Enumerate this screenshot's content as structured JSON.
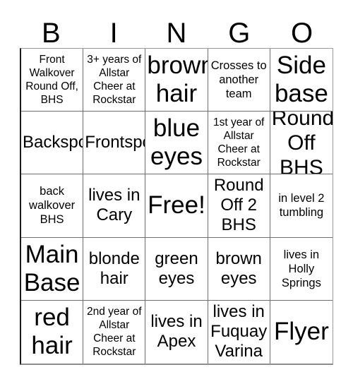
{
  "card": {
    "header_letters": [
      "B",
      "I",
      "N",
      "G",
      "O"
    ],
    "rows": [
      [
        {
          "text": "Front Walkover Round Off, BHS",
          "size": "t-xs"
        },
        {
          "text": "3+ years of Allstar Cheer at Rockstar",
          "size": "t-xs"
        },
        {
          "text": "brown hair",
          "size": "t-xl"
        },
        {
          "text": "Crosses to another team",
          "size": "t-sm"
        },
        {
          "text": "Side base",
          "size": "t-xl"
        }
      ],
      [
        {
          "text": "Backspot",
          "size": "t-md"
        },
        {
          "text": "Frontspot",
          "size": "t-md"
        },
        {
          "text": "blue eyes",
          "size": "t-xl"
        },
        {
          "text": "1st year of Allstar Cheer at Rockstar",
          "size": "t-xs"
        },
        {
          "text": "Round Off BHS",
          "size": "t-lg"
        }
      ],
      [
        {
          "text": "back walkover BHS",
          "size": "t-sm"
        },
        {
          "text": "lives in Cary",
          "size": "t-md"
        },
        {
          "text": "Free!",
          "size": "t-xl"
        },
        {
          "text": "Round Off 2 BHS",
          "size": "t-md"
        },
        {
          "text": "in level 2 tumbling",
          "size": "t-sm"
        }
      ],
      [
        {
          "text": "Main Base",
          "size": "t-xl"
        },
        {
          "text": "blonde hair",
          "size": "t-md"
        },
        {
          "text": "green eyes",
          "size": "t-md"
        },
        {
          "text": "brown eyes",
          "size": "t-md"
        },
        {
          "text": "lives in Holly Springs",
          "size": "t-sm"
        }
      ],
      [
        {
          "text": "red hair",
          "size": "t-xl"
        },
        {
          "text": "2nd year of Allstar Cheer at Rockstar",
          "size": "t-xs"
        },
        {
          "text": "lives in Apex",
          "size": "t-md"
        },
        {
          "text": "lives in Fuquay Varina",
          "size": "t-md"
        },
        {
          "text": "Flyer",
          "size": "t-xl"
        }
      ]
    ],
    "colors": {
      "text": "#000000",
      "background": "#ffffff",
      "grid_line": "#6f6f6f",
      "outer_border": "#1a1a1a"
    }
  }
}
